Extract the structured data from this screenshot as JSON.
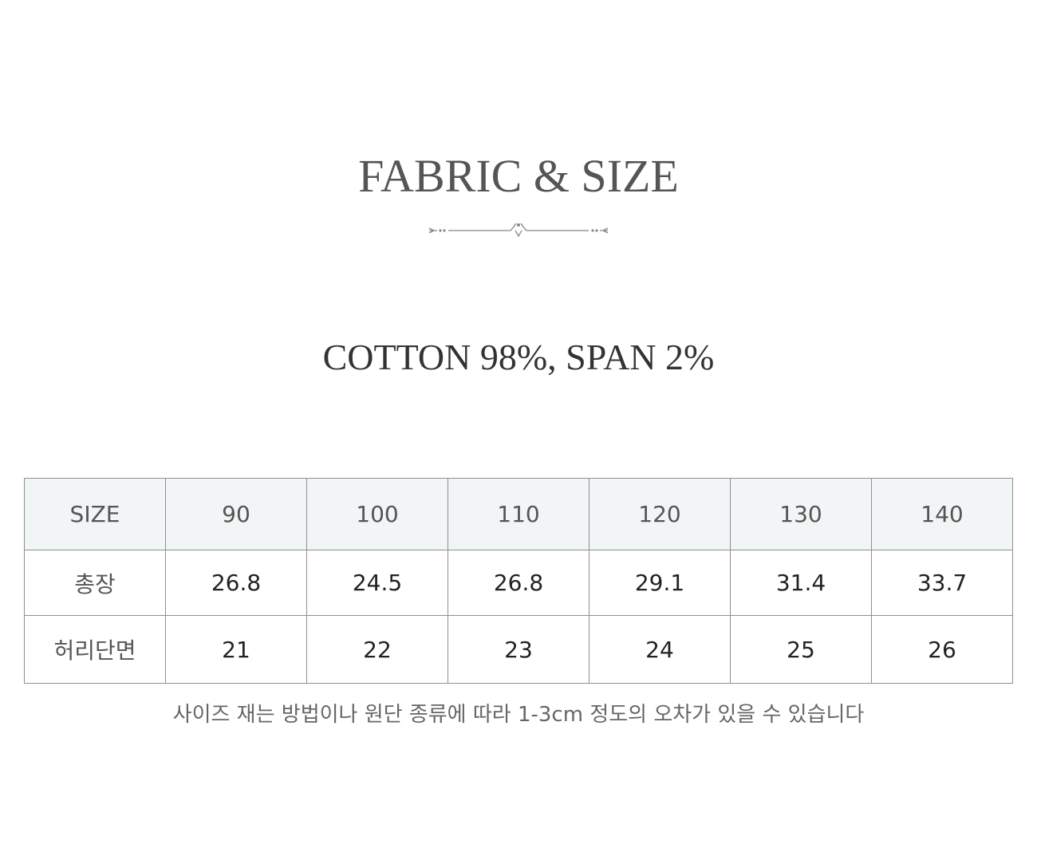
{
  "title": "FABRIC & SIZE",
  "fabric": "COTTON 98%, SPAN 2%",
  "table": {
    "header": [
      "SIZE",
      "90",
      "100",
      "110",
      "120",
      "130",
      "140"
    ],
    "rows": [
      {
        "label": "총장",
        "values": [
          "26.8",
          "24.5",
          "26.8",
          "29.1",
          "31.4",
          "33.7"
        ]
      },
      {
        "label": "허리단면",
        "values": [
          "21",
          "22",
          "23",
          "24",
          "25",
          "26"
        ]
      }
    ]
  },
  "note": "사이즈 재는 방법이나 원단 종류에 따라 1-3cm 정도의 오차가 있을 수 있습니다",
  "colors": {
    "header_bg": "#f1f5f5",
    "border": "#8f8f8f",
    "title": "#555555"
  }
}
